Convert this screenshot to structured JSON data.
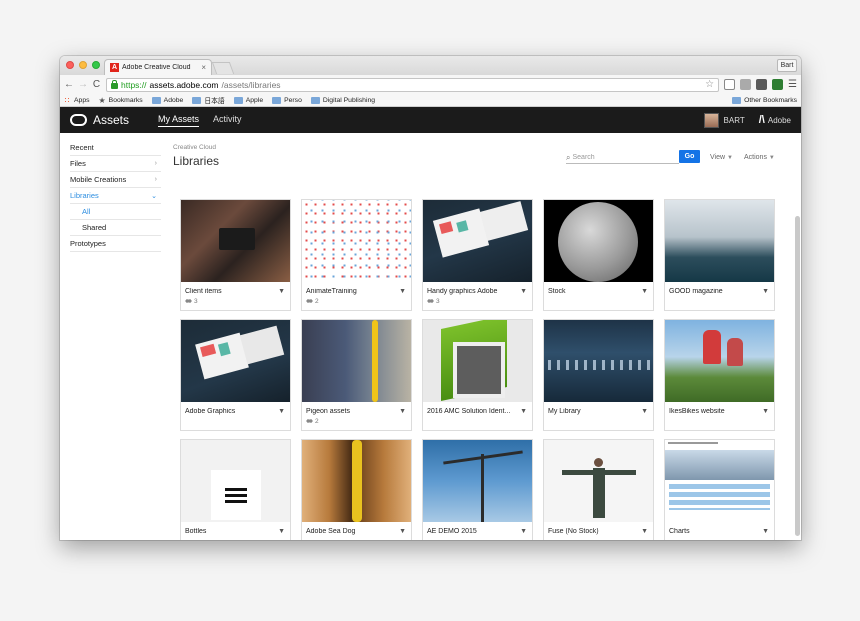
{
  "browser": {
    "tab_title": "Adobe Creative Cloud",
    "tab_favicon": "A",
    "tab_close": "×",
    "profile": "Bart",
    "url_scheme": "https://",
    "url_host": "assets.adobe.com",
    "url_path": "/assets/libraries",
    "bookmarks": [
      {
        "label": "Apps",
        "icon": "apps-icon"
      },
      {
        "label": "Bookmarks",
        "icon": "star-icon"
      },
      {
        "label": "Adobe",
        "icon": "folder-icon"
      },
      {
        "label": "日本語",
        "icon": "folder-icon"
      },
      {
        "label": "Apple",
        "icon": "folder-icon"
      },
      {
        "label": "Perso",
        "icon": "folder-icon"
      },
      {
        "label": "Digital Publishing",
        "icon": "folder-icon"
      }
    ],
    "other_bookmarks": "Other Bookmarks"
  },
  "appbar": {
    "brand": "Assets",
    "nav": [
      "My Assets",
      "Activity"
    ],
    "user": "BART",
    "adobe": "Adobe"
  },
  "sidebar": {
    "items": [
      {
        "label": "Recent",
        "chevron": ""
      },
      {
        "label": "Files",
        "chevron": "›"
      },
      {
        "label": "Mobile Creations",
        "chevron": "›"
      },
      {
        "label": "Libraries",
        "chevron": "⌄"
      },
      {
        "label": "All",
        "chevron": ""
      },
      {
        "label": "Shared",
        "chevron": ""
      },
      {
        "label": "Prototypes",
        "chevron": ""
      }
    ]
  },
  "main": {
    "breadcrumb": "Creative Cloud",
    "title": "Libraries",
    "search_placeholder": "Search",
    "go": "Go",
    "view": "View",
    "actions": "Actions"
  },
  "libraries": [
    {
      "name": "Client items",
      "members": "3"
    },
    {
      "name": "AnimateTraining",
      "members": "2"
    },
    {
      "name": "Handy graphics Adobe",
      "members": "3"
    },
    {
      "name": "Stock",
      "members": ""
    },
    {
      "name": "GOOD magazine",
      "members": ""
    },
    {
      "name": "Adobe Graphics",
      "members": ""
    },
    {
      "name": "Pigeon assets",
      "members": "2"
    },
    {
      "name": "2016 AMC Solution Ident...",
      "members": ""
    },
    {
      "name": "My Library",
      "members": ""
    },
    {
      "name": "IkesBikes website",
      "members": ""
    },
    {
      "name": "Bottles",
      "members": ""
    },
    {
      "name": "Adobe Sea Dog",
      "members": ""
    },
    {
      "name": "AE DEMO 2015",
      "members": ""
    },
    {
      "name": "Fuse (No Stock)",
      "members": ""
    },
    {
      "name": "Charts",
      "members": ""
    }
  ]
}
